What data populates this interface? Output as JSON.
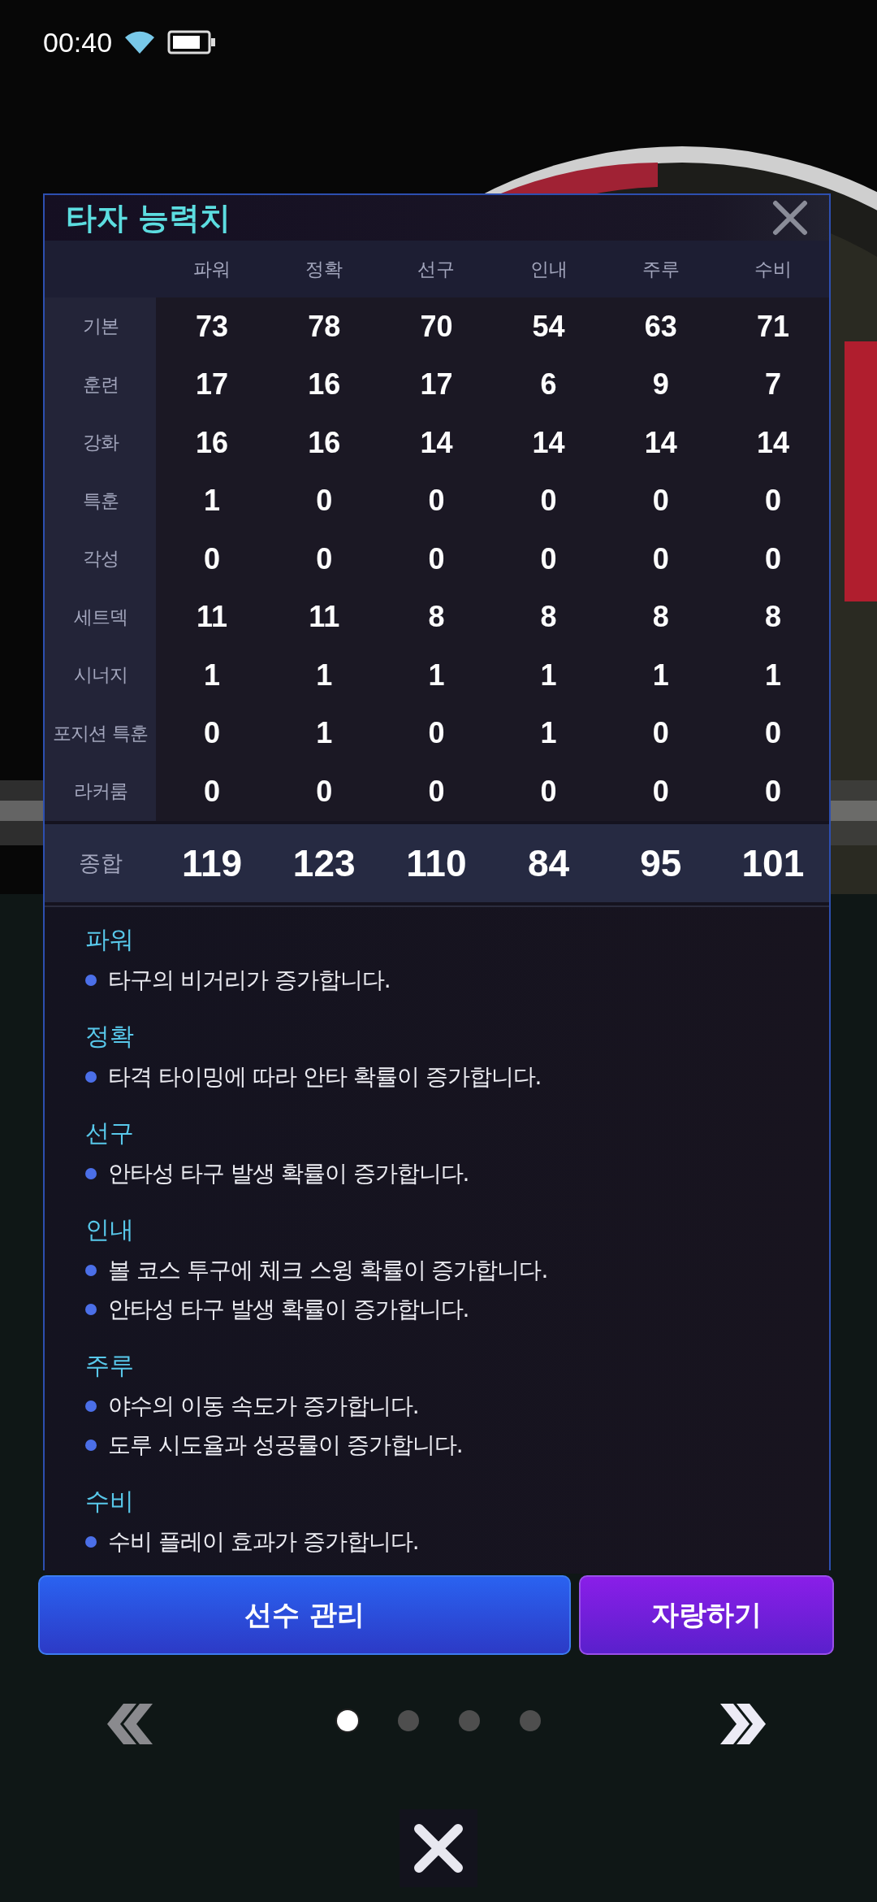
{
  "status_bar": {
    "time": "00:40"
  },
  "modal": {
    "title": "타자 능력치",
    "columns": [
      "파워",
      "정확",
      "선구",
      "인내",
      "주루",
      "수비"
    ],
    "rows": [
      {
        "label": "기본",
        "values": [
          "73",
          "78",
          "70",
          "54",
          "63",
          "71"
        ]
      },
      {
        "label": "훈련",
        "values": [
          "17",
          "16",
          "17",
          "6",
          "9",
          "7"
        ]
      },
      {
        "label": "강화",
        "values": [
          "16",
          "16",
          "14",
          "14",
          "14",
          "14"
        ]
      },
      {
        "label": "특훈",
        "values": [
          "1",
          "0",
          "0",
          "0",
          "0",
          "0"
        ]
      },
      {
        "label": "각성",
        "values": [
          "0",
          "0",
          "0",
          "0",
          "0",
          "0"
        ]
      },
      {
        "label": "세트덱",
        "values": [
          "11",
          "11",
          "8",
          "8",
          "8",
          "8"
        ]
      },
      {
        "label": "시너지",
        "values": [
          "1",
          "1",
          "1",
          "1",
          "1",
          "1"
        ]
      },
      {
        "label": "포지션 특훈",
        "values": [
          "0",
          "1",
          "0",
          "1",
          "0",
          "0"
        ]
      },
      {
        "label": "라커룸",
        "values": [
          "0",
          "0",
          "0",
          "0",
          "0",
          "0"
        ]
      }
    ],
    "total": {
      "label": "종합",
      "values": [
        "119",
        "123",
        "110",
        "84",
        "95",
        "101"
      ]
    },
    "descriptions": [
      {
        "heading": "파워",
        "lines": [
          "타구의 비거리가 증가합니다."
        ]
      },
      {
        "heading": "정확",
        "lines": [
          "타격 타이밍에 따라 안타 확률이 증가합니다."
        ]
      },
      {
        "heading": "선구",
        "lines": [
          "안타성 타구 발생 확률이 증가합니다."
        ]
      },
      {
        "heading": "인내",
        "lines": [
          "볼 코스 투구에 체크 스윙 확률이 증가합니다.",
          "안타성 타구 발생 확률이 증가합니다."
        ]
      },
      {
        "heading": "주루",
        "lines": [
          "야수의 이동 속도가 증가합니다.",
          "도루 시도율과 성공률이 증가합니다."
        ]
      },
      {
        "heading": "수비",
        "lines": [
          "수비 플레이 효과가 증가합니다."
        ]
      }
    ]
  },
  "buttons": [
    {
      "kind": "primary",
      "label": "선수 관리"
    },
    {
      "kind": "secondary",
      "label": "자랑하기"
    }
  ],
  "pager": {
    "prev_disabled": true,
    "pages": [
      {
        "selected": true
      },
      {
        "selected": false
      },
      {
        "selected": false
      },
      {
        "selected": false
      }
    ]
  }
}
